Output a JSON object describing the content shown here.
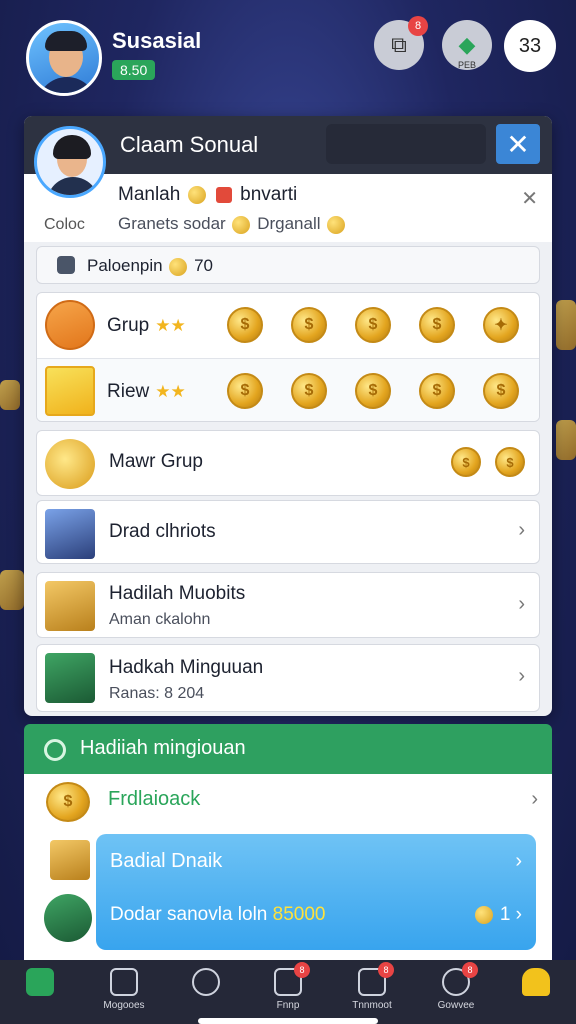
{
  "header": {
    "app_name": "Susasial",
    "coin_balance": "8.50",
    "icon1_badge": "8",
    "icon2_caption": "PEB",
    "counter": "33"
  },
  "panel": {
    "title": "Claam Sonual",
    "close_label": "✕",
    "profile": {
      "name_prefix": "Manlah",
      "name_suffix": "bnvarti",
      "left_label": "Coloc",
      "sub_prefix": "Granets sodar",
      "sub_suffix": "Drganall"
    },
    "points": {
      "label": "Paloenpin",
      "value": "70"
    },
    "rewards": [
      {
        "label": "Grup",
        "stars": "★★"
      },
      {
        "label": "Riew",
        "stars": "★★"
      }
    ],
    "list": [
      {
        "title": "Mawr Grup",
        "sub": ""
      },
      {
        "title": "Drad clhriots",
        "sub": ""
      },
      {
        "title": "Hadilah Muobits",
        "sub": "Aman ckalohn"
      },
      {
        "title": "Hadkah Minguuan",
        "sub": "Ranas: 8 204"
      }
    ]
  },
  "bottom": {
    "section_title": "Hadiiah mingiouan",
    "row1": "Frdlaioack",
    "blue_title": "Badial Dnaik",
    "blue_text": "Dodar sanovla loln",
    "blue_amount": "85000",
    "blue_right": "1"
  },
  "nav": [
    {
      "label": ""
    },
    {
      "label": "Mogooes"
    },
    {
      "label": ""
    },
    {
      "label": "Fnnp",
      "badge": "8"
    },
    {
      "label": "Tnnmoot",
      "badge": "8"
    },
    {
      "label": "Gowvee",
      "badge": "8"
    },
    {
      "label": ""
    }
  ],
  "colors": {
    "brand_green": "#2ea060",
    "accent_blue": "#3b86d6",
    "gold": "#e3a51f"
  }
}
